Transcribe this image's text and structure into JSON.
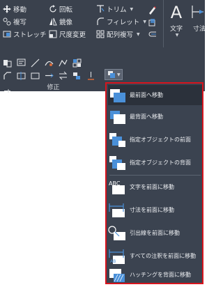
{
  "ribbon": {
    "modify_tools": [
      {
        "icon": "move-icon",
        "label": "移動"
      },
      {
        "icon": "copy-icon",
        "label": "複写"
      },
      {
        "icon": "stretch-icon",
        "label": "ストレッチ"
      },
      {
        "icon": "rotate-icon",
        "label": "回転"
      },
      {
        "icon": "mirror-icon",
        "label": "鏡像"
      },
      {
        "icon": "scale-icon",
        "label": "尺度変更"
      },
      {
        "icon": "trim-icon",
        "label": "トリム"
      },
      {
        "icon": "fillet-icon",
        "label": "フィレット"
      },
      {
        "icon": "array-icon",
        "label": "配列複写"
      }
    ],
    "annotation": {
      "text_label": "文字",
      "dim_label": "寸法"
    },
    "panel_title": "修正"
  },
  "dropdown": {
    "items": [
      {
        "label": "最前面へ移動",
        "icon": "bring-to-front-icon"
      },
      {
        "label": "最背面へ移動",
        "icon": "send-to-back-icon"
      },
      {
        "label": "指定オブジェクトの前面",
        "icon": "bring-above-objects-icon"
      },
      {
        "label": "指定オブジェクトの背面",
        "icon": "send-under-objects-icon"
      },
      {
        "label": "文字を前面に移動",
        "icon": "bring-text-to-front-icon"
      },
      {
        "label": "寸法を前面に移動",
        "icon": "bring-dimensions-to-front-icon"
      },
      {
        "label": "引出線を前面に移動",
        "icon": "bring-leaders-to-front-icon"
      },
      {
        "label": "すべての注釈を前面に移動",
        "icon": "bring-all-annotations-to-front-icon"
      },
      {
        "label": "ハッチングを背面に移動",
        "icon": "send-hatches-to-back-icon"
      }
    ]
  },
  "colors": {
    "ribbon_bg": "#3a414d",
    "highlight_border": "#d8141d",
    "icon_blue": "#4a90d9"
  }
}
